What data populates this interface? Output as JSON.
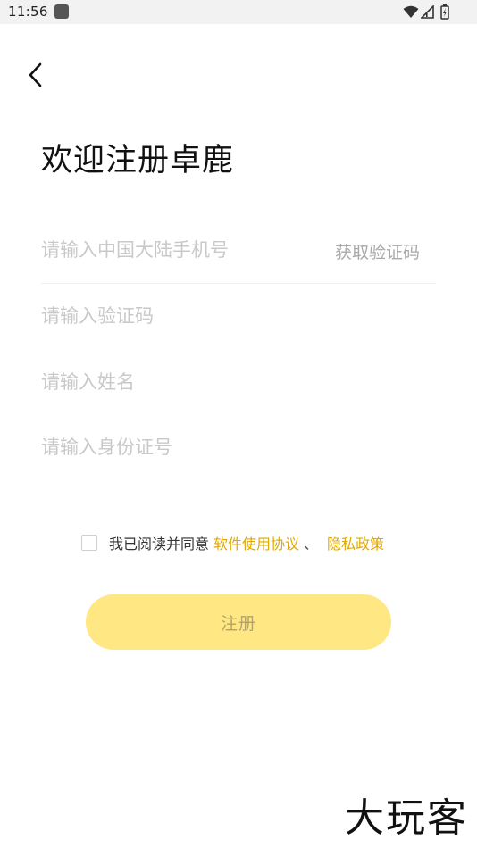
{
  "status_bar": {
    "time": "11:56"
  },
  "header": {
    "title": "欢迎注册卓鹿"
  },
  "form": {
    "phone_placeholder": "请输入中国大陆手机号",
    "get_code_label": "获取验证码",
    "code_placeholder": "请输入验证码",
    "name_placeholder": "请输入姓名",
    "id_placeholder": "请输入身份证号"
  },
  "agreement": {
    "text": "我已阅读并同意",
    "terms_link": "软件使用协议",
    "separator": "、",
    "privacy_link": "隐私政策",
    "checked": false
  },
  "register_button": {
    "label": "注册"
  },
  "watermark": {
    "text": "大玩客"
  },
  "colors": {
    "accent": "#e0a800",
    "button_bg": "#ffe784",
    "placeholder": "#c9c9c9"
  }
}
